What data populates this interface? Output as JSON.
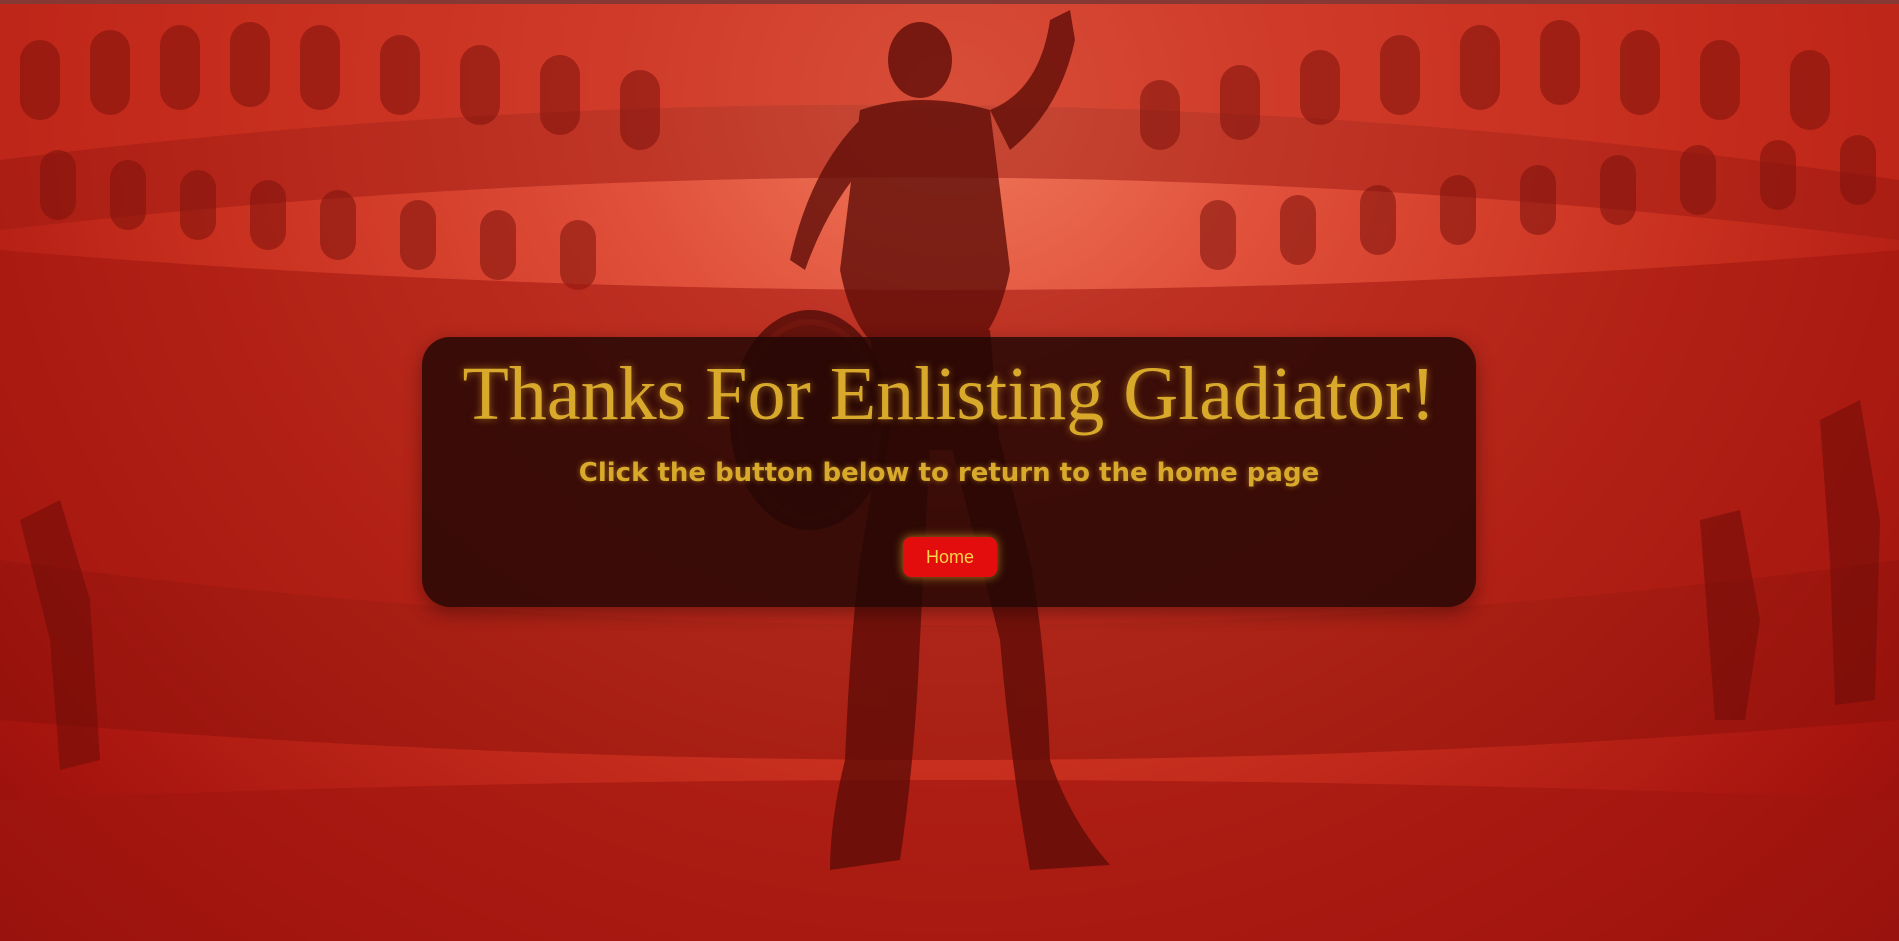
{
  "hero": {
    "title": "Thanks For Enlisting Gladiator!",
    "subtitle": "Click the button below to return to the home page",
    "home_button_label": "Home"
  },
  "background": {
    "image": "gladiator-in-colosseum-arena",
    "tint_color": "#c41e14"
  },
  "colors": {
    "accent_gold": "#d8a92a",
    "button_red": "#e30d0d"
  }
}
